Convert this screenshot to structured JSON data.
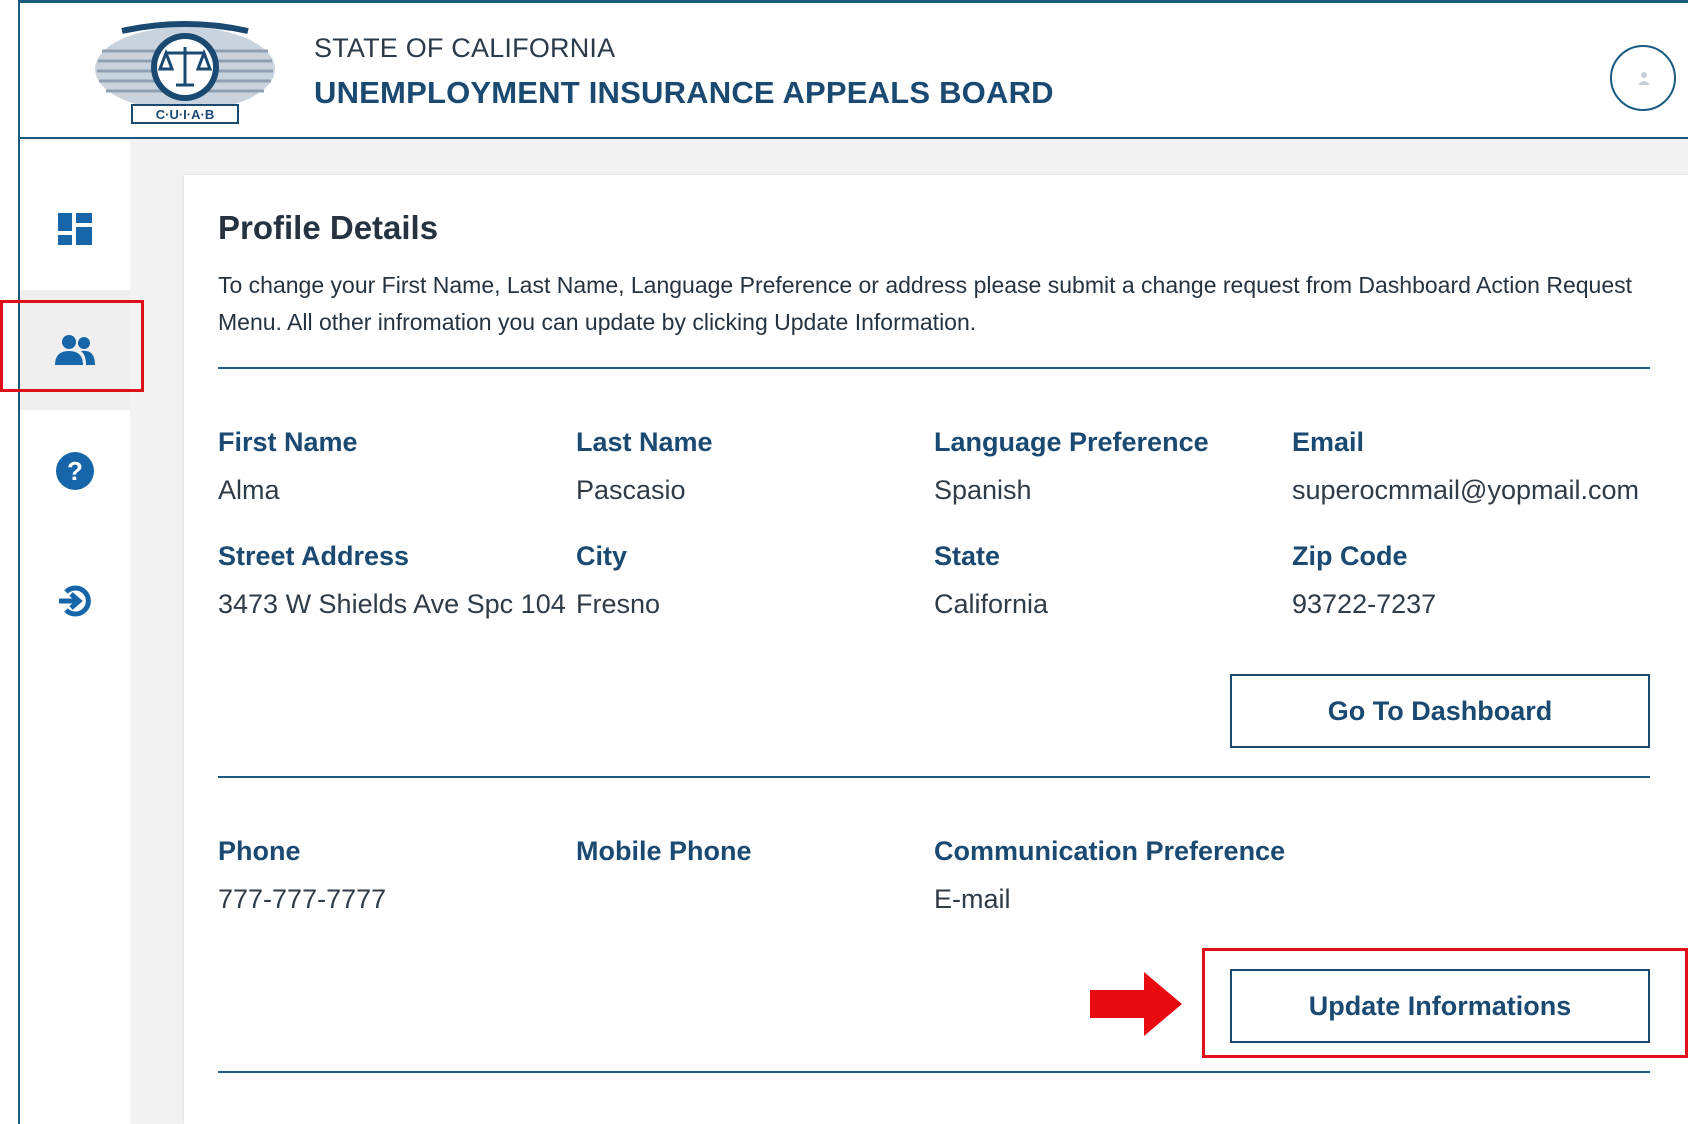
{
  "header": {
    "logo_text": "C·U·I·A·B",
    "state": "STATE OF CALIFORNIA",
    "board": "UNEMPLOYMENT INSURANCE APPEALS BOARD",
    "avatar_icon": "user-avatar-icon"
  },
  "sidebar": {
    "items": [
      {
        "icon": "dashboard-icon",
        "active": false
      },
      {
        "icon": "users-icon",
        "active": true
      },
      {
        "icon": "help-icon",
        "active": false
      },
      {
        "icon": "logout-icon",
        "active": false
      }
    ]
  },
  "profile": {
    "title": "Profile Details",
    "description": "To change your First Name, Last Name, Language Preference or address please submit a change request from Dashboard Action Request Menu. All other infromation you can update by clicking Update Information.",
    "fields": {
      "first_name": {
        "label": "First Name",
        "value": "Alma"
      },
      "last_name": {
        "label": "Last Name",
        "value": "Pascasio"
      },
      "language": {
        "label": "Language Preference",
        "value": "Spanish"
      },
      "email": {
        "label": "Email",
        "value": "superocmmail@yopmail.com"
      },
      "street": {
        "label": "Street Address",
        "value": "3473 W Shields Ave Spc 104"
      },
      "city": {
        "label": "City",
        "value": "Fresno"
      },
      "state": {
        "label": "State",
        "value": "California"
      },
      "zip": {
        "label": "Zip Code",
        "value": "93722-7237"
      }
    },
    "go_dashboard_label": "Go To Dashboard",
    "contact": {
      "phone": {
        "label": "Phone",
        "value": "777-777-7777"
      },
      "mobile": {
        "label": "Mobile Phone",
        "value": ""
      },
      "communication": {
        "label": "Communication Preference",
        "value": "E-mail"
      }
    },
    "update_label": "Update Informations"
  },
  "colors": {
    "brand_blue": "#1a4a72",
    "highlight_red": "#e0101a",
    "icon_blue": "#1565a8"
  }
}
